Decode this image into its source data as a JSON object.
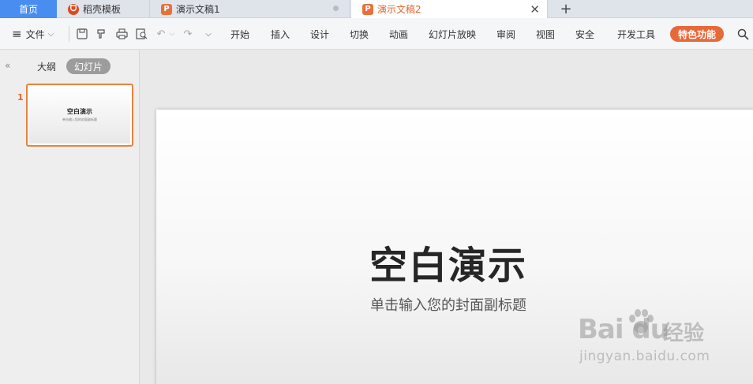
{
  "tabs": {
    "home": "首页",
    "template": "稻壳模板",
    "doc1": "演示文稿1",
    "doc2": "演示文稿2",
    "add": "+"
  },
  "toolbar": {
    "menu_icon": "≡",
    "file": "文件",
    "items": [
      "开始",
      "插入",
      "设计",
      "切换",
      "动画",
      "幻灯片放映",
      "审阅",
      "视图",
      "安全",
      "开发工具"
    ],
    "special": "特色功能",
    "search_icon": "search-icon"
  },
  "leftpanel": {
    "collapse": "«",
    "outline": "大纲",
    "slides": "幻灯片",
    "slide_number": "1",
    "thumb_title": "空白演示",
    "thumb_sub": "单击输入您的封面副标题"
  },
  "slide": {
    "title": "空白演示",
    "subtitle": "单击输入您的封面副标题"
  },
  "watermark": {
    "logo": "Bai du",
    "text": "经验",
    "url": "jingyan.baidu.com"
  },
  "colors": {
    "accent": "#e5652d",
    "home_tab": "#4a8df0",
    "special_button": "#e8683a"
  }
}
